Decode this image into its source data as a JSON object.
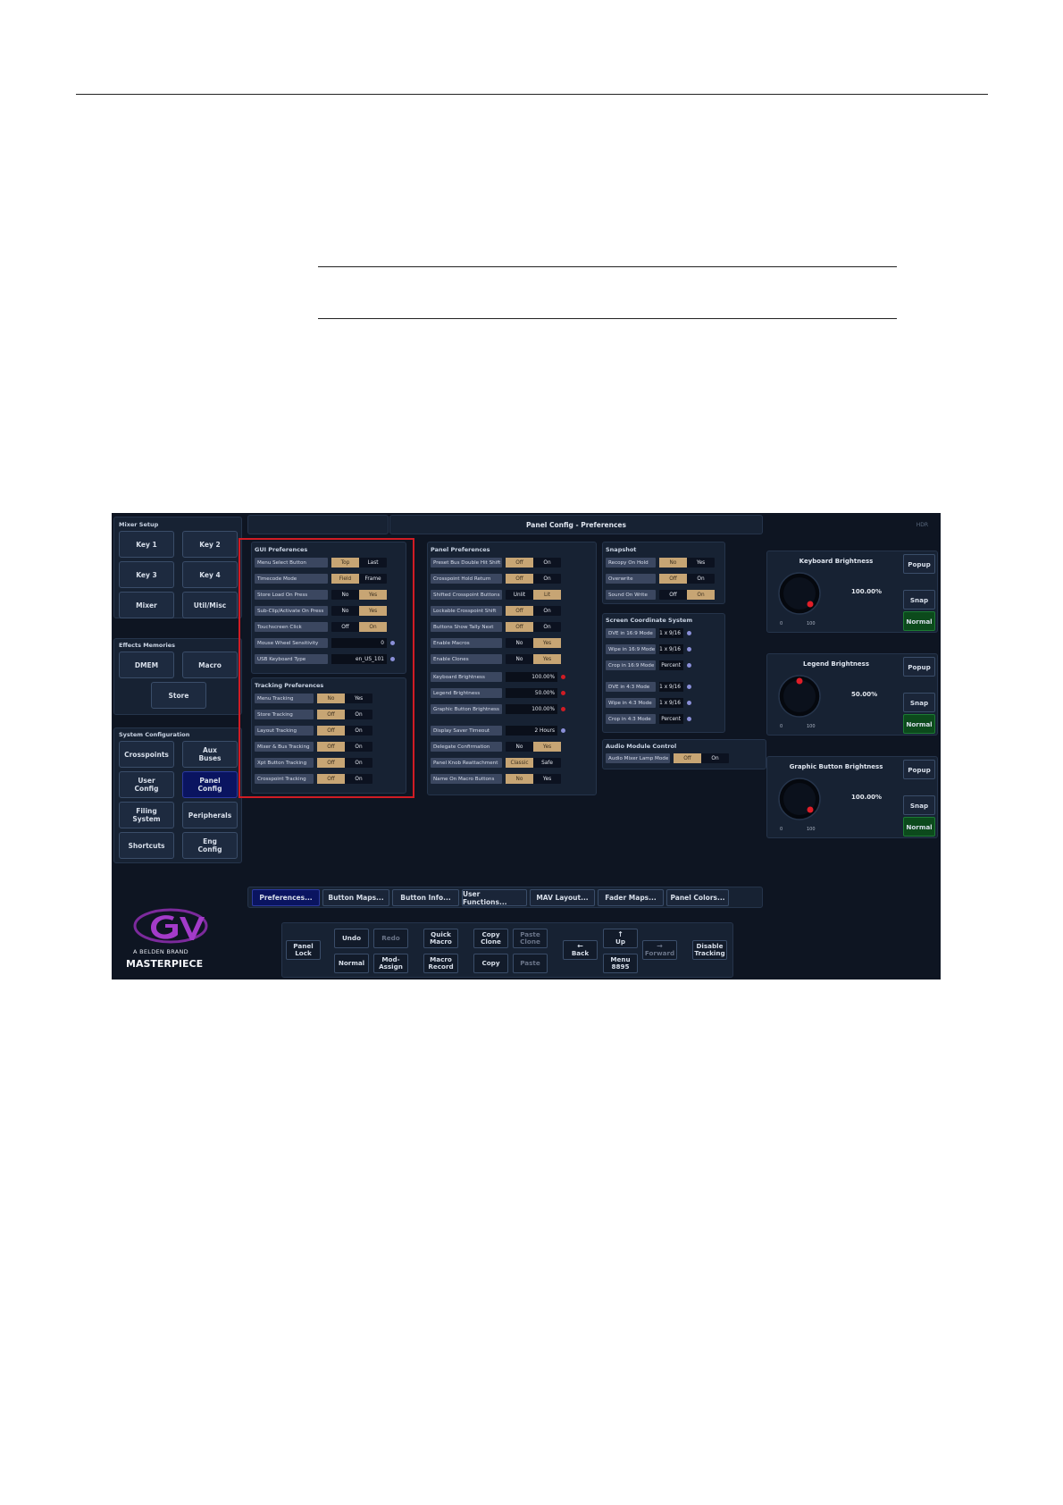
{
  "page_title": "Panel Config - Preferences",
  "corner_badge": "HDR",
  "mixer_setup": {
    "title": "Mixer Setup",
    "buttons": [
      "Key 1",
      "Key 2",
      "Key 3",
      "Key 4",
      "Mixer",
      "Util/Misc"
    ]
  },
  "effects_memories": {
    "title": "Effects Memories",
    "buttons": [
      "DMEM",
      "Macro",
      "Store"
    ]
  },
  "system_config": {
    "title": "System Configuration",
    "buttons": [
      "Crosspoints",
      "Aux\nBuses",
      "User\nConfig",
      "Panel\nConfig",
      "Filing\nSystem",
      "Peripherals",
      "Shortcuts",
      "Eng\nConfig"
    ]
  },
  "gui_prefs": {
    "title": "GUI Preferences",
    "rows": [
      {
        "label": "Menu Select Button",
        "a": "Top",
        "b": "Last",
        "sel": "a"
      },
      {
        "label": "Timecode Mode",
        "a": "Field",
        "b": "Frame",
        "sel": "a"
      },
      {
        "label": "Store Load On Press",
        "a": "No",
        "b": "Yes",
        "sel": "b"
      },
      {
        "label": "Sub-Clip/Activate On Press",
        "a": "No",
        "b": "Yes",
        "sel": "b"
      },
      {
        "label": "Touchscreen Click",
        "a": "Off",
        "b": "On",
        "sel": "b"
      }
    ],
    "values": [
      {
        "label": "Mouse Wheel Sensitivity",
        "value": "0"
      },
      {
        "label": "USB Keyboard Type",
        "value": "en_US_101"
      }
    ]
  },
  "tracking_prefs": {
    "title": "Tracking Preferences",
    "rows": [
      {
        "label": "Menu Tracking",
        "a": "No",
        "b": "Yes",
        "sel": "a"
      },
      {
        "label": "Store Tracking",
        "a": "Off",
        "b": "On",
        "sel": "a"
      },
      {
        "label": "Layout Tracking",
        "a": "Off",
        "b": "On",
        "sel": "a"
      },
      {
        "label": "Mixer & Bus Tracking",
        "a": "Off",
        "b": "On",
        "sel": "a"
      },
      {
        "label": "Xpt Button Tracking",
        "a": "Off",
        "b": "On",
        "sel": "a"
      },
      {
        "label": "Crosspoint Tracking",
        "a": "Off",
        "b": "On",
        "sel": "a"
      }
    ]
  },
  "panel_prefs": {
    "title": "Panel Preferences",
    "rows": [
      {
        "label": "Preset Bus Double Hit Shift",
        "a": "Off",
        "b": "On",
        "sel": "a"
      },
      {
        "label": "Crosspoint Hold Return",
        "a": "Off",
        "b": "On",
        "sel": "a"
      },
      {
        "label": "Shifted Crosspoint Buttons",
        "a": "Unlit",
        "b": "Lit",
        "sel": "b"
      },
      {
        "label": "Lockable Crosspoint Shift",
        "a": "Off",
        "b": "On",
        "sel": "a"
      },
      {
        "label": "Buttons Show Tally Next",
        "a": "Off",
        "b": "On",
        "sel": "a"
      },
      {
        "label": "Enable Macros",
        "a": "No",
        "b": "Yes",
        "sel": "b"
      },
      {
        "label": "Enable Clones",
        "a": "No",
        "b": "Yes",
        "sel": "b"
      }
    ],
    "values": [
      {
        "label": "Keyboard Brightness",
        "value": "100.00%"
      },
      {
        "label": "Legend Brightness",
        "value": "50.00%"
      },
      {
        "label": "Graphic Button Brightness",
        "value": "100.00%"
      },
      {
        "label": "Display Saver Timeout",
        "value": "2 Hours"
      }
    ],
    "rows2": [
      {
        "label": "Delegate Confirmation",
        "a": "No",
        "b": "Yes",
        "sel": "b"
      },
      {
        "label": "Panel Knob Reattachment",
        "a": "Classic",
        "b": "Safe",
        "sel": "a"
      },
      {
        "label": "Name On Macro Buttons",
        "a": "No",
        "b": "Yes",
        "sel": "a"
      }
    ]
  },
  "snapshot": {
    "title": "Snapshot",
    "rows": [
      {
        "label": "Recopy On Hold",
        "a": "No",
        "b": "Yes",
        "sel": "a"
      },
      {
        "label": "Overwrite",
        "a": "Off",
        "b": "On",
        "sel": "a"
      },
      {
        "label": "Sound On Write",
        "a": "Off",
        "b": "On",
        "sel": "b"
      }
    ]
  },
  "screen_coord": {
    "title": "Screen Coordinate System",
    "values": [
      {
        "label": "DVE in 16:9 Mode",
        "value": "1 x 9/16"
      },
      {
        "label": "Wipe in 16:9 Mode",
        "value": "1 x 9/16"
      },
      {
        "label": "Crop in 16:9 Mode",
        "value": "Percent"
      },
      {
        "label": "DVE in 4:3 Mode",
        "value": "1 x 9/16"
      },
      {
        "label": "Wipe in 4:3 Mode",
        "value": "1 x 9/16"
      },
      {
        "label": "Crop in 4:3 Mode",
        "value": "Percent"
      }
    ]
  },
  "audio_module": {
    "title": "Audio Module Control",
    "rows": [
      {
        "label": "Audio Mixer Lamp Mode",
        "a": "Off",
        "b": "On",
        "sel": "a"
      }
    ]
  },
  "knobs": [
    {
      "title": "Keyboard Brightness",
      "value": "100.00%",
      "min": "0",
      "max": "100",
      "level": 1.0
    },
    {
      "title": "Legend Brightness",
      "value": "50.00%",
      "min": "0",
      "max": "100",
      "level": 0.5
    },
    {
      "title": "Graphic Button Brightness",
      "value": "100.00%",
      "min": "0",
      "max": "100",
      "level": 1.0
    }
  ],
  "knob_buttons": {
    "popup": "Popup",
    "snap": "Snap",
    "normal": "Normal"
  },
  "tabs": [
    "Preferences...",
    "Button Maps...",
    "Button Info...",
    "User Functions...",
    "MAV Layout...",
    "Fader Maps...",
    "Panel Colors..."
  ],
  "controls": {
    "panel_lock": "Panel\nLock",
    "undo": "Undo",
    "redo": "Redo",
    "normal": "Normal",
    "mod_assign": "Mod-\nAssign",
    "quick_macro": "Quick\nMacro",
    "macro_record": "Macro\nRecord",
    "copy_clone": "Copy\nClone",
    "paste_clone": "Paste\nClone",
    "copy": "Copy",
    "paste": "Paste",
    "back": "Back",
    "up": "Up",
    "forward": "Forward",
    "menu": "Menu\n8895",
    "disable_tracking": "Disable\nTracking"
  },
  "brand": {
    "tagline": "A BELDEN BRAND",
    "product": "MASTERPIECE",
    "logo_text": "GV"
  },
  "colors": {
    "accent": "#c7a574",
    "highlight_box": "#d01c24",
    "active_button": "#0a1460",
    "normal_green": "#0c4a1c"
  }
}
